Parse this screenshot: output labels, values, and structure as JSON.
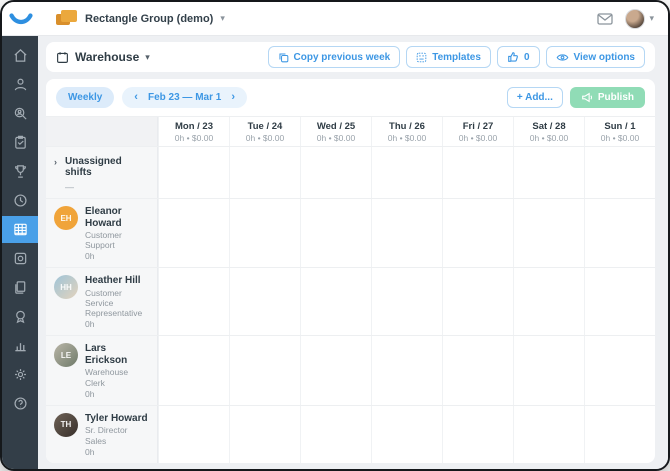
{
  "topbar": {
    "org_name": "Rectangle Group (demo)",
    "accent_color": "#3d97e4"
  },
  "sidebar": {
    "items": [
      {
        "icon": "home-icon",
        "active": false
      },
      {
        "icon": "employees-icon",
        "active": false
      },
      {
        "icon": "search-user-icon",
        "active": false
      },
      {
        "icon": "tasks-icon",
        "active": false
      },
      {
        "icon": "trophy-icon",
        "active": false
      },
      {
        "icon": "time-clock-icon",
        "active": false
      },
      {
        "icon": "schedule-grid-icon",
        "active": true
      },
      {
        "icon": "photo-icon",
        "active": false
      },
      {
        "icon": "documents-icon",
        "active": false
      },
      {
        "icon": "badge-icon",
        "active": false
      },
      {
        "icon": "reports-icon",
        "active": false
      },
      {
        "icon": "settings-gear-icon",
        "active": false
      },
      {
        "icon": "help-icon",
        "active": false
      }
    ],
    "bg_color": "#333e48",
    "active_color": "#4aa0e8"
  },
  "header": {
    "title": "Warehouse",
    "copy_week_label": "Copy previous week",
    "templates_label": "Templates",
    "likes_count": "0",
    "view_options_label": "View options"
  },
  "toolbar": {
    "view_mode": "Weekly",
    "date_range": "Feb 23 — Mar 1",
    "prev_arrow": "‹",
    "next_arrow": "›",
    "add_label": "+ Add...",
    "publish_label": "Publish",
    "publish_color": "#90dcb6"
  },
  "schedule": {
    "days": [
      {
        "label": "Mon / 23",
        "summary": "0h • $0.00"
      },
      {
        "label": "Tue / 24",
        "summary": "0h • $0.00"
      },
      {
        "label": "Wed / 25",
        "summary": "0h • $0.00"
      },
      {
        "label": "Thu / 26",
        "summary": "0h • $0.00"
      },
      {
        "label": "Fri / 27",
        "summary": "0h • $0.00"
      },
      {
        "label": "Sat / 28",
        "summary": "0h • $0.00"
      },
      {
        "label": "Sun / 1",
        "summary": "0h • $0.00"
      }
    ],
    "unassigned": {
      "chevron": "›",
      "name": "Unassigned shifts",
      "sub": "—"
    },
    "employees": [
      {
        "name": "Eleanor Howard",
        "role": "Customer Support",
        "hours": "0h",
        "initials": "EH",
        "avatar_color": "#f0a43a"
      },
      {
        "name": "Heather Hill",
        "role": "Customer Service Representative",
        "hours": "0h",
        "initials": "HH",
        "avatar_color": "#9fc4d8"
      },
      {
        "name": "Lars Erickson",
        "role": "Warehouse Clerk",
        "hours": "0h",
        "initials": "LE",
        "avatar_color": "#8a9184"
      },
      {
        "name": "Tyler Howard",
        "role": "Sr. Director Sales",
        "hours": "0h",
        "initials": "TH",
        "avatar_color": "#5c4f45"
      }
    ]
  }
}
